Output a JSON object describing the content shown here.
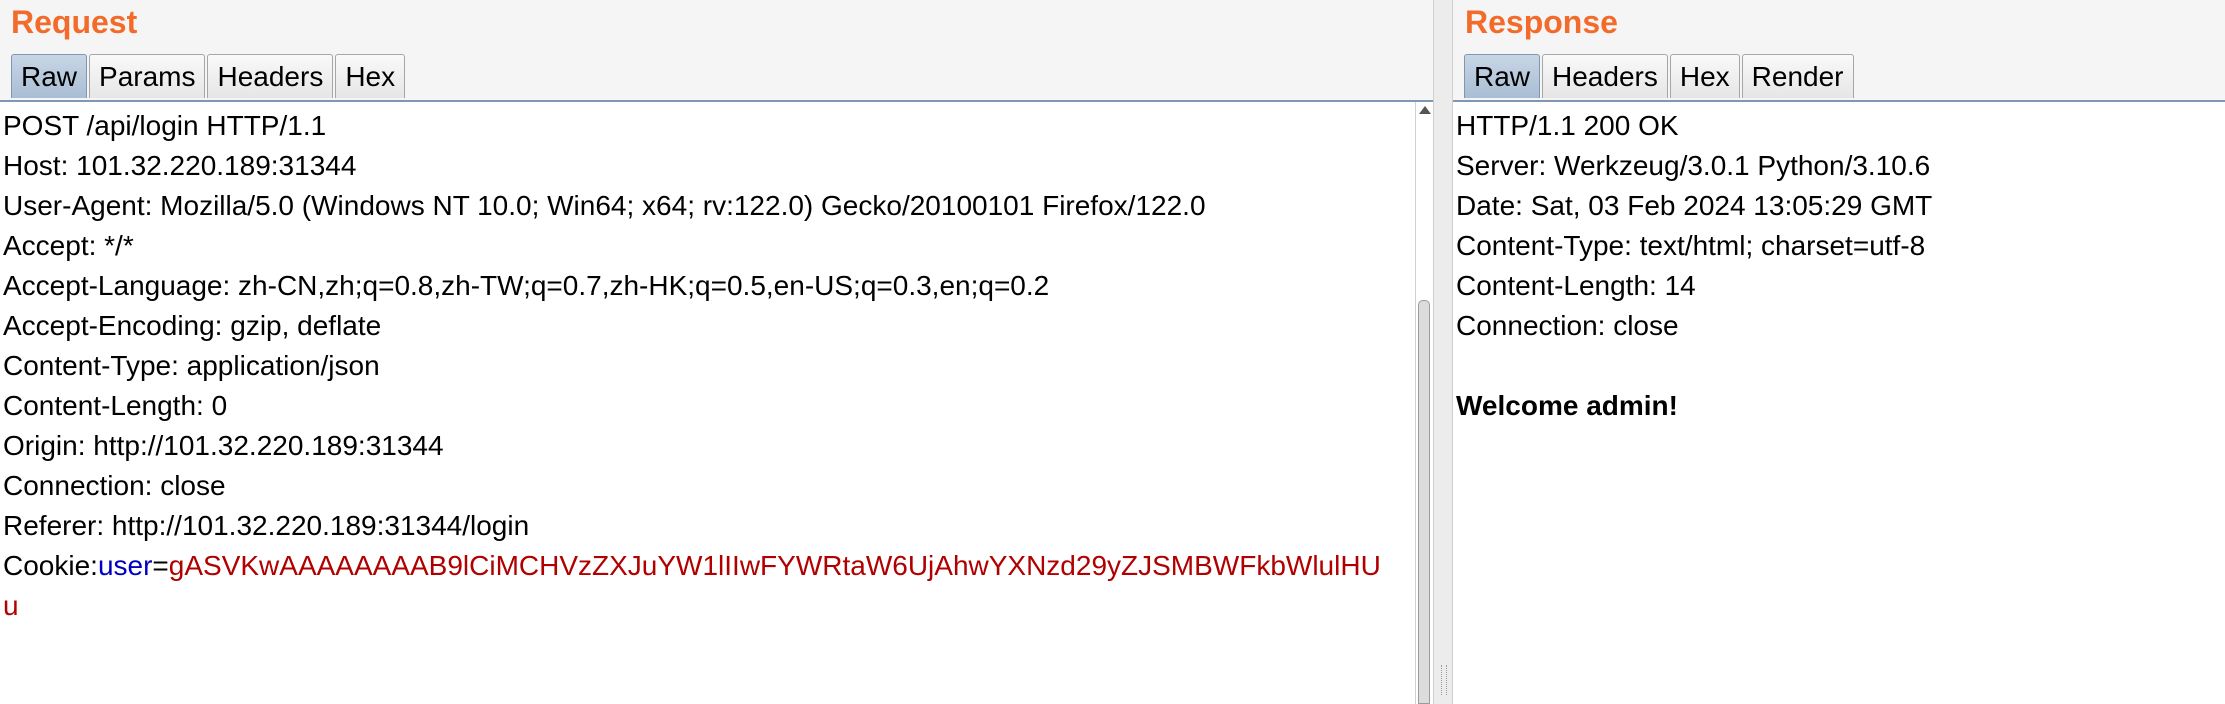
{
  "request": {
    "title": "Request",
    "tabs": [
      {
        "label": "Raw",
        "active": true
      },
      {
        "label": "Params",
        "active": false
      },
      {
        "label": "Headers",
        "active": false
      },
      {
        "label": "Hex",
        "active": false
      }
    ],
    "lines": [
      "POST /api/login HTTP/1.1",
      "Host: 101.32.220.189:31344",
      "User-Agent: Mozilla/5.0 (Windows NT 10.0; Win64; x64; rv:122.0) Gecko/20100101 Firefox/122.0",
      "Accept: */*",
      "Accept-Language: zh-CN,zh;q=0.8,zh-TW;q=0.7,zh-HK;q=0.5,en-US;q=0.3,en;q=0.2",
      "Accept-Encoding: gzip, deflate",
      "Content-Type: application/json",
      "Content-Length: 0",
      "Origin: http://101.32.220.189:31344",
      "Connection: close",
      "Referer: http://101.32.220.189:31344/login"
    ],
    "cookie": {
      "name": "Cookie:",
      "key": "user",
      "eq": "=",
      "value_line1": "gASVKwAAAAAAAAB9lCiMCHVzZXJuYW1lIIwFYWRtaW6UjAhwYXNzd29yZJSMBWFkbWlulHU",
      "value_line2": "u"
    }
  },
  "response": {
    "title": "Response",
    "tabs": [
      {
        "label": "Raw",
        "active": true
      },
      {
        "label": "Headers",
        "active": false
      },
      {
        "label": "Hex",
        "active": false
      },
      {
        "label": "Render",
        "active": false
      }
    ],
    "lines": [
      "HTTP/1.1 200 OK",
      "Server: Werkzeug/3.0.1 Python/3.10.6",
      "Date: Sat, 03 Feb 2024 13:05:29 GMT",
      "Content-Type: text/html; charset=utf-8",
      "Content-Length: 14",
      "Connection: close"
    ],
    "body": "Welcome admin!"
  }
}
